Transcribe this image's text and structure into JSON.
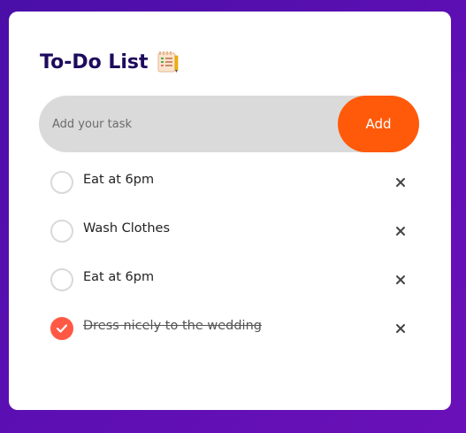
{
  "app": {
    "title": "To-Do List",
    "title_icon": "checklist-note-icon"
  },
  "input": {
    "placeholder": "Add your task",
    "value": ""
  },
  "add_button": {
    "label": "Add"
  },
  "tasks": [
    {
      "text": "Eat at 6pm",
      "done": false
    },
    {
      "text": "Wash Clothes",
      "done": false
    },
    {
      "text": "Eat at 6pm",
      "done": false
    },
    {
      "text": "Dress nicely to the wedding",
      "done": true
    }
  ],
  "icons": {
    "unchecked": "empty-circle-icon",
    "checked": "checked-circle-icon",
    "delete": "close-icon"
  },
  "colors": {
    "accent": "#ff5a0a",
    "check": "#ff5945",
    "title": "#1e0b5c",
    "background_start": "#4a0fa8",
    "background_end": "#6a10b8"
  }
}
